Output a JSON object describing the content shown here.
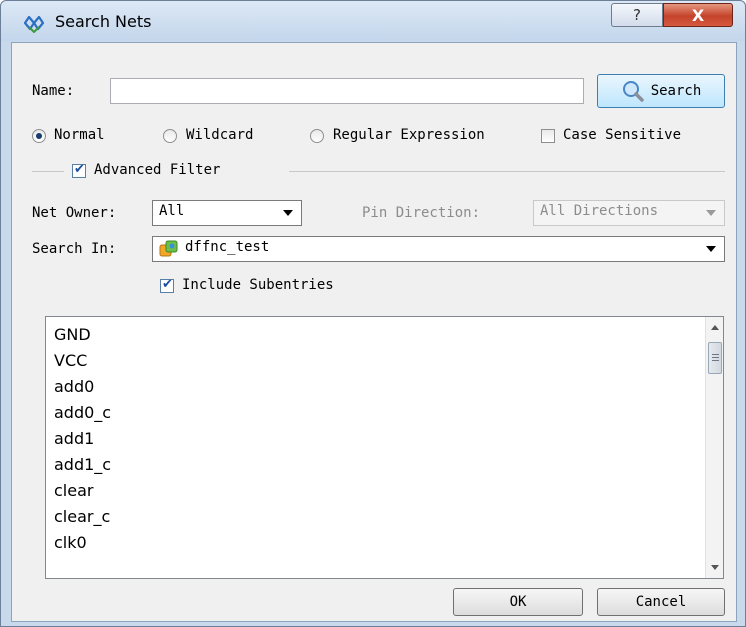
{
  "window": {
    "title": "Search Nets",
    "help_glyph": "?",
    "close_glyph": "X"
  },
  "search": {
    "name_label": "Name:",
    "name_value": "",
    "search_button": "Search"
  },
  "match_modes": {
    "normal": "Normal",
    "wildcard": "Wildcard",
    "regex": "Regular Expression",
    "selected": "Normal",
    "case_sensitive": "Case Sensitive",
    "case_sensitive_checked": false
  },
  "filter": {
    "advanced_label": "Advanced Filter",
    "advanced_checked": true,
    "net_owner_label": "Net Owner:",
    "net_owner_value": "All",
    "pin_direction_label": "Pin Direction:",
    "pin_direction_value": "All Directions",
    "search_in_label": "Search In:",
    "search_in_value": "dffnc_test",
    "include_subentries": "Include Subentries",
    "include_subentries_checked": true
  },
  "results": [
    "GND",
    "VCC",
    "add0",
    "add0_c",
    "add1",
    "add1_c",
    "clear",
    "clear_c",
    "clk0"
  ],
  "footer": {
    "ok": "OK",
    "cancel": "Cancel"
  },
  "icons": {
    "app": "network-icon",
    "search": "magnifier-icon",
    "module": "module-icon"
  },
  "colors": {
    "title_bar": "#c4d6ec",
    "close_button": "#c4432b",
    "dialog_bg": "#f0f0f0",
    "search_button": "#bee6fd"
  }
}
